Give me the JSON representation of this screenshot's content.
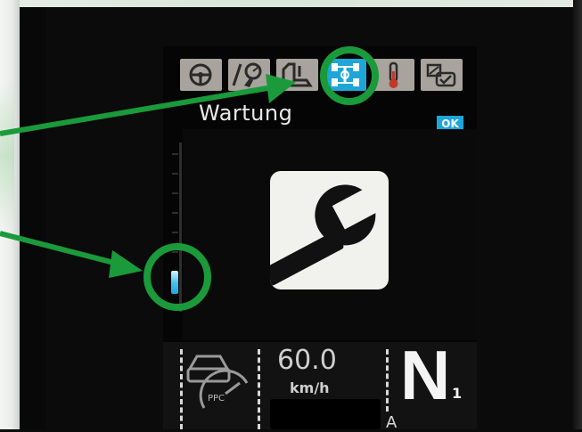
{
  "screen": {
    "title": "Wartung",
    "ok_badge": "OK",
    "tabs": [
      {
        "icon": "steering-wheel-icon",
        "active": false
      },
      {
        "icon": "wrench-gauge-icon",
        "active": false
      },
      {
        "icon": "pedal-icon",
        "active": false
      },
      {
        "icon": "chassis-axle-icon",
        "active": true
      },
      {
        "icon": "thermometer-icon",
        "active": false
      },
      {
        "icon": "settings-check-icon",
        "active": false
      }
    ],
    "main_icon": "wrench-icon",
    "bottom": {
      "ppc_label": "PPC",
      "speed_value": "60.0",
      "speed_unit": "km/h",
      "gear_letter": "N",
      "gear_number": "1",
      "sub_indicator": "A"
    }
  },
  "colors": {
    "accent": "#1ea6d9",
    "annotation": "#1a9a3a",
    "tab_inactive": "#a8a39c",
    "tile": "#f1f1ee"
  }
}
